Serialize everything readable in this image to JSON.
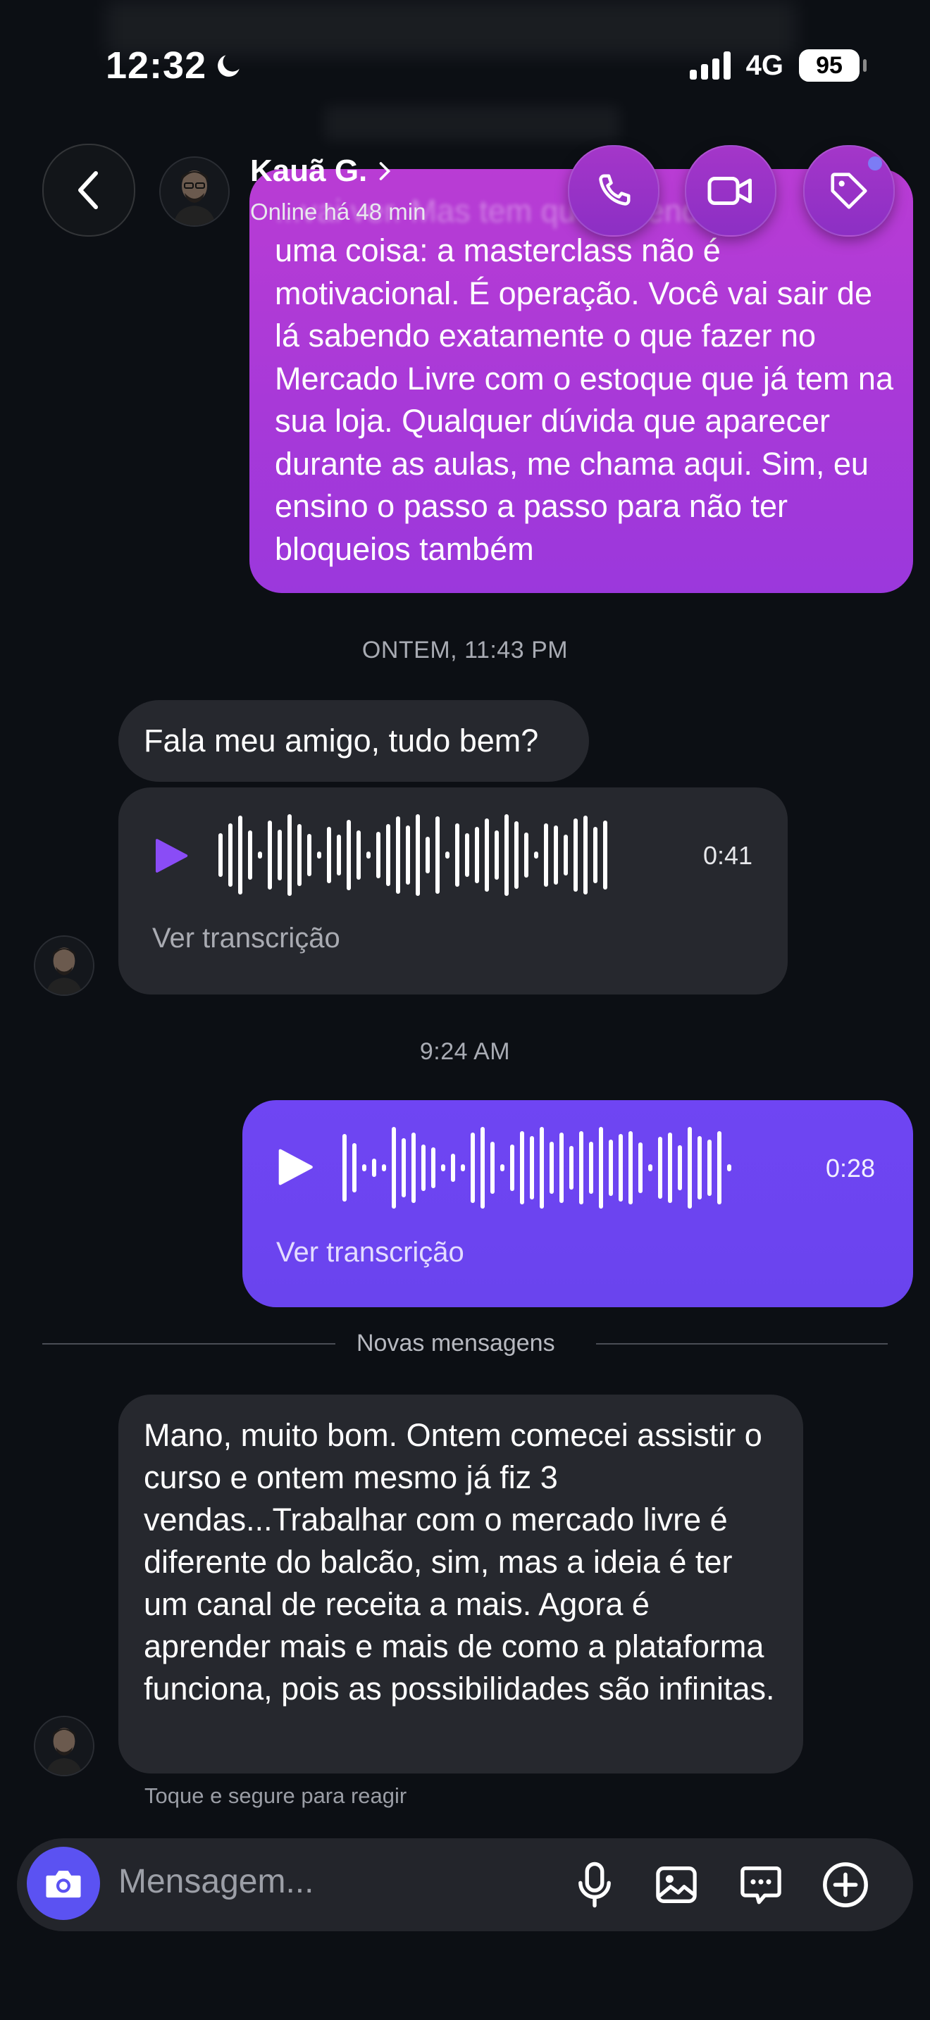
{
  "status_bar": {
    "time": "12:32",
    "network": "4G",
    "battery": "95"
  },
  "header": {
    "contact_name": "Kauã G.",
    "contact_status": "Online há 48 min"
  },
  "colors": {
    "sent_gradient_top": "#b93cd4",
    "sent_voice": "#6b45f0",
    "incoming_bubble": "#26282e",
    "accent_camera": "#5b52f2",
    "play_incoming": "#8a4cf6"
  },
  "messages": {
    "sent_text": {
      "ghost_line": "...vai ver. Mas tem que entender",
      "text": "uma coisa: a masterclass não é motivacional. É operação. Você vai sair de lá sabendo exatamente o que fazer no Mercado Livre com o estoque que já tem na sua loja. Qualquer dúvida que aparecer durante as aulas, me chama aqui. Sim, eu ensino o passo a passo para não ter bloqueios também"
    },
    "time_1": "ONTEM, 11:43 PM",
    "incoming_1": {
      "text": "Fala meu amigo, tudo bem?"
    },
    "incoming_voice": {
      "duration": "0:41",
      "transcript_link": "Ver transcrição"
    },
    "time_2": "9:24 AM",
    "sent_voice": {
      "duration": "0:28",
      "transcript_link": "Ver transcrição"
    },
    "divider": "Novas mensagens",
    "incoming_2": {
      "text": "Mano, muito bom. Ontem comecei assistir o curso e ontem mesmo já fiz 3 vendas...Trabalhar com o mercado livre é diferente do balcão, sim, mas a ideia é ter um canal de receita a mais. Agora é aprender mais e mais de como a plataforma funciona, pois as possibilidades são infinitas."
    },
    "hint": "Toque e segure para reagir"
  },
  "composer": {
    "placeholder": "Mensagem...",
    "icons": [
      "camera-icon",
      "microphone-icon",
      "image-icon",
      "sticker-icon",
      "plus-icon"
    ]
  }
}
